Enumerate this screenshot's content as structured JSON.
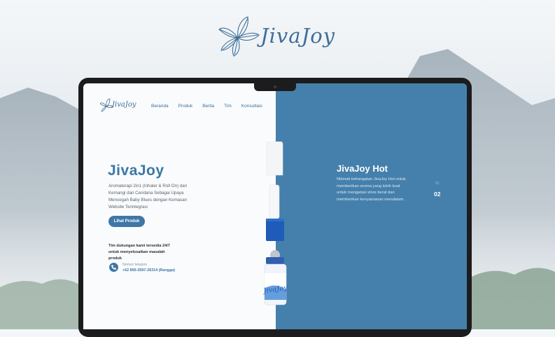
{
  "brand": {
    "name": "JivaJoy",
    "leaf_icon": "leaf-icon"
  },
  "site": {
    "logo_text": "JivaJoy",
    "nav": [
      "Beranda",
      "Produk",
      "Berita",
      "Tim",
      "Konsultasi"
    ],
    "hero": {
      "title": "JivaJoy",
      "description": "Aromaterapi 2in1 (Inhaler & Roll On) dari Kemangi dan Cendana Sebagai Upaya Mencegah Baby Blues dengan Kemasan Website Terintegrasi",
      "button_label": "Lihat Produk"
    },
    "support": {
      "text": "Tim dukungan kami tersedia 24/7 untuk menyelesaikan masalah produk",
      "phone_label": "Nomor telepon",
      "phone_number": "+62 895-3597-26314 (Rangga)",
      "phone_icon": "phone-icon"
    },
    "product_label": "JivaJoy",
    "slide": {
      "title": "JivaJoy Hot",
      "description": "Nikmati kehangatan JivaJoy Hot untuk memberikan aroma yang lebih kuat untuk mengatasi stres berat dan memberikan kenyamanan mendalam.",
      "pager_prev": "01",
      "pager_current": "02"
    }
  },
  "colors": {
    "primary_blue": "#4580ac",
    "brand_text": "#3f6f98",
    "button": "#3f77a6"
  }
}
